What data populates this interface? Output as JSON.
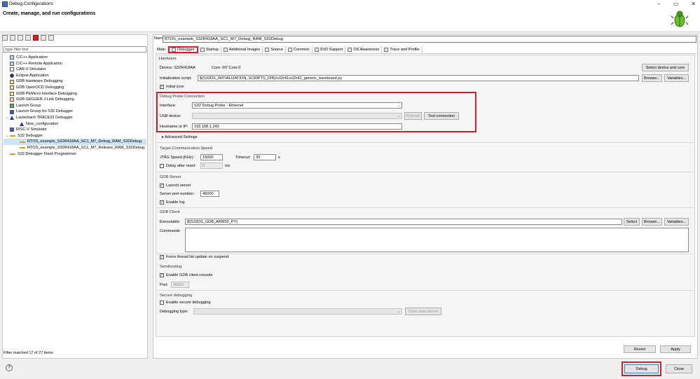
{
  "window": {
    "title": "Debug Configurations",
    "header": "Create, manage, and run configurations"
  },
  "left": {
    "filter_placeholder": "type filter text",
    "tree": [
      {
        "label": "C/C++ Application",
        "icon": "cpp"
      },
      {
        "label": "C/C++ Remote Application",
        "icon": "cpp"
      },
      {
        "label": "CAR-V Simulator",
        "icon": "car"
      },
      {
        "label": "Eclipse Application",
        "icon": "ecl"
      },
      {
        "label": "GDB Hardware Debugging",
        "icon": "gdb"
      },
      {
        "label": "GDB OpenOCD Debugging",
        "icon": "gdb"
      },
      {
        "label": "GDB PEMicro Interface Debugging",
        "icon": "gdb"
      },
      {
        "label": "GDB SEGGER J-Link Debugging",
        "icon": "gdb"
      },
      {
        "label": "Launch Group",
        "icon": "grn"
      },
      {
        "label": "Launch Group for S32 Debugger",
        "icon": "lau"
      },
      {
        "label": "Lauterbach TRACE32 Debugger",
        "icon": "tri",
        "expander": "v"
      },
      {
        "label": "New_configuration",
        "icon": "tri",
        "indent": 1
      },
      {
        "label": "RISC-V Simulator",
        "icon": "lau"
      },
      {
        "label": "S32 Debugger",
        "icon": "lin",
        "expander": "v"
      },
      {
        "label": "RTOS_example_S32R418AA_SC1_M7_Debug_RAM_S32Debug",
        "icon": "lin",
        "indent": 1,
        "selected": true
      },
      {
        "label": "RTOS_example_S32R418AA_SC1_M7_Release_RAM_S32Debug",
        "icon": "lin",
        "indent": 1
      },
      {
        "label": "S32 Debugger Flash Programmer",
        "icon": "lin"
      }
    ],
    "filter_status": "Filter matched 17 of 27 items"
  },
  "right": {
    "name_label": "Name:",
    "name_value": "RTOS_example_S32R418AA_SC1_M7_Debug_RAM_S32Debug",
    "tabs": [
      "Main",
      "Debugger",
      "Startup",
      "Additional Images",
      "Source",
      "Common",
      "SVD Support",
      "OS Awareness",
      "Trace and Profile"
    ],
    "hardware": {
      "section": "Hardware",
      "device": "Device: S32R418AA",
      "core": "Core: M7 Core 0",
      "select_device_btn": "Select device and core",
      "init_label": "Initialization script:",
      "init_value": "${S32DS_INITIALIZATION_SCRIPTS_DIR}/s32r41/s32r41_generic_bareboard.py",
      "browse": "Browse...",
      "variables": "Variables...",
      "initial_core": "Initial core"
    },
    "probe": {
      "section": "Debug Probe Connection",
      "interface_label": "Interface:",
      "interface_value": "S32 Debug Probe - Ethernet",
      "usb_label": "USB device:",
      "refresh": "Refresh",
      "test_connection": "Test connection",
      "host_label": "Hostname or IP:",
      "host_value": "192.168.1.243"
    },
    "advanced": "Advanced Settings",
    "speed": {
      "section": "Target Communication Speed",
      "jtag_label": "JTAG Speed (KHz):",
      "jtag_value": "16000",
      "timeout_label": "Timeout:",
      "timeout_value": "30",
      "timeout_unit": "s",
      "delay_label": "Delay after reset:",
      "delay_value": "0",
      "delay_unit": "ms"
    },
    "gdb_server": {
      "section": "GDB Server",
      "launch": "Launch server",
      "port_label": "Server port number:",
      "port_value": "45000",
      "enable_log": "Enable log"
    },
    "gdb_client": {
      "section": "GDB Client",
      "exe_label": "Executable:",
      "exe_value": "${S32DS_GDB_ARM32_PY}",
      "select": "Select",
      "browse": "Browse...",
      "variables": "Variables...",
      "commands_label": "Commands:"
    },
    "force_update": "Force thread list update on suspend",
    "semihosting": {
      "section": "Semihosting",
      "enable": "Enable GDB client console",
      "port_label": "Port:",
      "port_value": "45001"
    },
    "secure": {
      "section": "Secure debugging",
      "enable": "Enable secure debugging",
      "type_label": "Debugging type:",
      "clear": "Clear data stored"
    },
    "revert": "Revert",
    "apply": "Apply"
  },
  "footer": {
    "debug": "Debug",
    "close": "Close",
    "help": "?"
  },
  "colors": {
    "highlight": "#d3202a",
    "selection": "#cce4f7"
  }
}
